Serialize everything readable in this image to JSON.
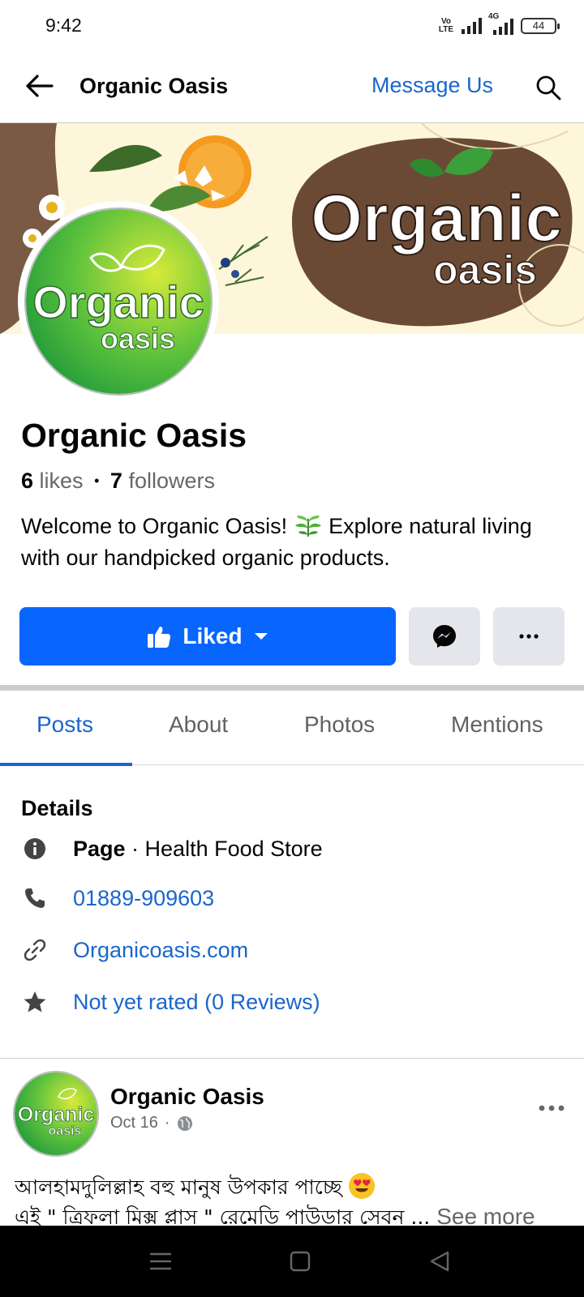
{
  "status_bar": {
    "time": "9:42",
    "volte": "Vo LTE",
    "network": "4G",
    "battery": "44"
  },
  "header": {
    "title": "Organic Oasis",
    "message_label": "Message Us"
  },
  "cover": {
    "logo_word_1": "Organic",
    "logo_word_2": "oasis"
  },
  "page": {
    "name": "Organic Oasis",
    "likes_count": "6",
    "likes_label": "likes",
    "separator": "•",
    "followers_count": "7",
    "followers_label": "followers",
    "intro_part1": "Welcome to Organic Oasis!",
    "intro_part2": "Explore natural living with our handpicked organic products."
  },
  "actions": {
    "liked_label": "Liked"
  },
  "tabs": [
    {
      "label": "Posts",
      "active": true
    },
    {
      "label": "About",
      "active": false
    },
    {
      "label": "Photos",
      "active": false
    },
    {
      "label": "Mentions",
      "active": false
    }
  ],
  "details": {
    "title": "Details",
    "category_prefix": "Page",
    "category": " · Health Food Store",
    "phone": "01889-909603",
    "website": "Organicoasis.com",
    "rating": "Not yet rated (0 Reviews)"
  },
  "post": {
    "author": "Organic Oasis",
    "date": "Oct 16",
    "dot": "·",
    "text_line1": "আলহামদুলিল্লাহ বহু মানুষ উপকার পাচ্ছে",
    "text_line2": "এই \" ত্রিফলা মিক্স প্লাস \" রেমেডি পাউডার সেবন ...",
    "see_more": "See more"
  },
  "colors": {
    "brand_blue": "#0866ff",
    "link_blue": "#1a66cc",
    "button_gray": "#e4e6eb",
    "muted_text": "#65676b",
    "logo_green": "#3cae3c",
    "cover_brown": "#6b4a35"
  },
  "icons": {
    "back": "arrow-left-icon",
    "search": "search-icon",
    "like": "thumbs-up-icon",
    "caret": "caret-down-icon",
    "messenger": "messenger-icon",
    "more": "more-horizontal-icon",
    "info": "info-icon",
    "phone": "phone-icon",
    "link": "link-icon",
    "star": "star-icon",
    "globe": "globe-icon"
  }
}
